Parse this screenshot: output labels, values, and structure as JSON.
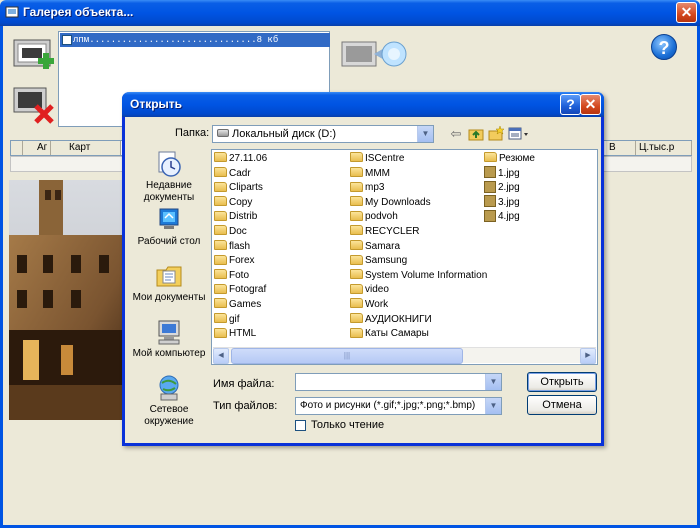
{
  "main_window": {
    "title": "Галерея объекта...",
    "thumb_row_text": "лпм...............................8 кб",
    "grid_columns": [
      "Аг",
      "Карт",
      "В",
      "Ц.тыс.р"
    ]
  },
  "dialog": {
    "title": "Открыть",
    "look_in_label": "Папка:",
    "look_in_value": "Локальный диск (D:)",
    "places": [
      {
        "label": "Недавние документы",
        "icon": "recent-documents-icon"
      },
      {
        "label": "Рабочий стол",
        "icon": "desktop-icon"
      },
      {
        "label": "Мои документы",
        "icon": "my-documents-icon"
      },
      {
        "label": "Мой компьютер",
        "icon": "my-computer-icon"
      },
      {
        "label": "Сетевое окружение",
        "icon": "network-places-icon"
      }
    ],
    "files_col1": [
      "27.11.06",
      "Cadr",
      "Cliparts",
      "Copy",
      "Distrib",
      "Doc",
      "flash",
      "Forex",
      "Foto",
      "Fotograf",
      "Games",
      "gif",
      "HTML"
    ],
    "files_col2": [
      "ISCentre",
      "MMM",
      "mp3",
      "My Downloads",
      "podvoh",
      "RECYCLER",
      "Samara",
      "Samsung",
      "System Volume Information",
      "video",
      "Work",
      "АУДИОКНИГИ",
      "Каты Самары"
    ],
    "files_col3": [
      {
        "name": "Резюме",
        "type": "folder"
      },
      {
        "name": "1.jpg",
        "type": "jpg"
      },
      {
        "name": "2.jpg",
        "type": "jpg"
      },
      {
        "name": "3.jpg",
        "type": "jpg"
      },
      {
        "name": "4.jpg",
        "type": "jpg"
      }
    ],
    "filename_label": "Имя файла:",
    "filename_value": "",
    "filetype_label": "Тип файлов:",
    "filetype_value": "Фото и рисунки (*.gif;*.jpg;*.png;*.bmp)",
    "readonly_label": "Только чтение",
    "readonly_checked": false,
    "open_button": "Открыть",
    "cancel_button": "Отмена"
  }
}
